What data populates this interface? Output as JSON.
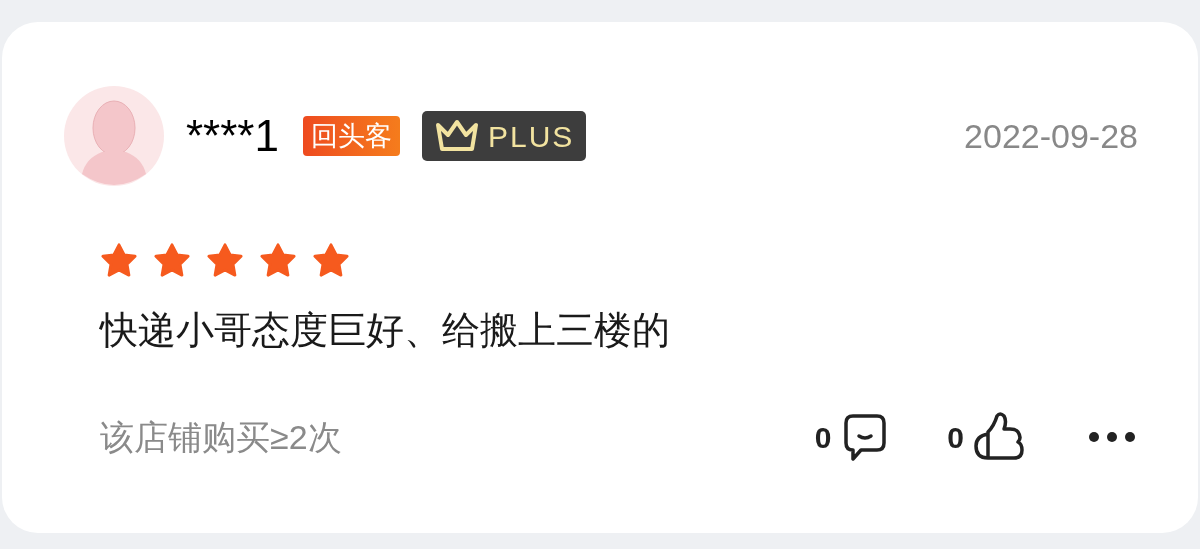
{
  "review": {
    "username": "****1",
    "badges": [
      {
        "kind": "returning",
        "label": "回头客"
      },
      {
        "kind": "plus",
        "label": "PLUS"
      }
    ],
    "date": "2022-09-28",
    "stars": 5,
    "text": "快递小哥态度巨好、给搬上三楼的",
    "purchase_note": "该店铺购买≥2次",
    "comment_count": "0",
    "like_count": "0"
  }
}
